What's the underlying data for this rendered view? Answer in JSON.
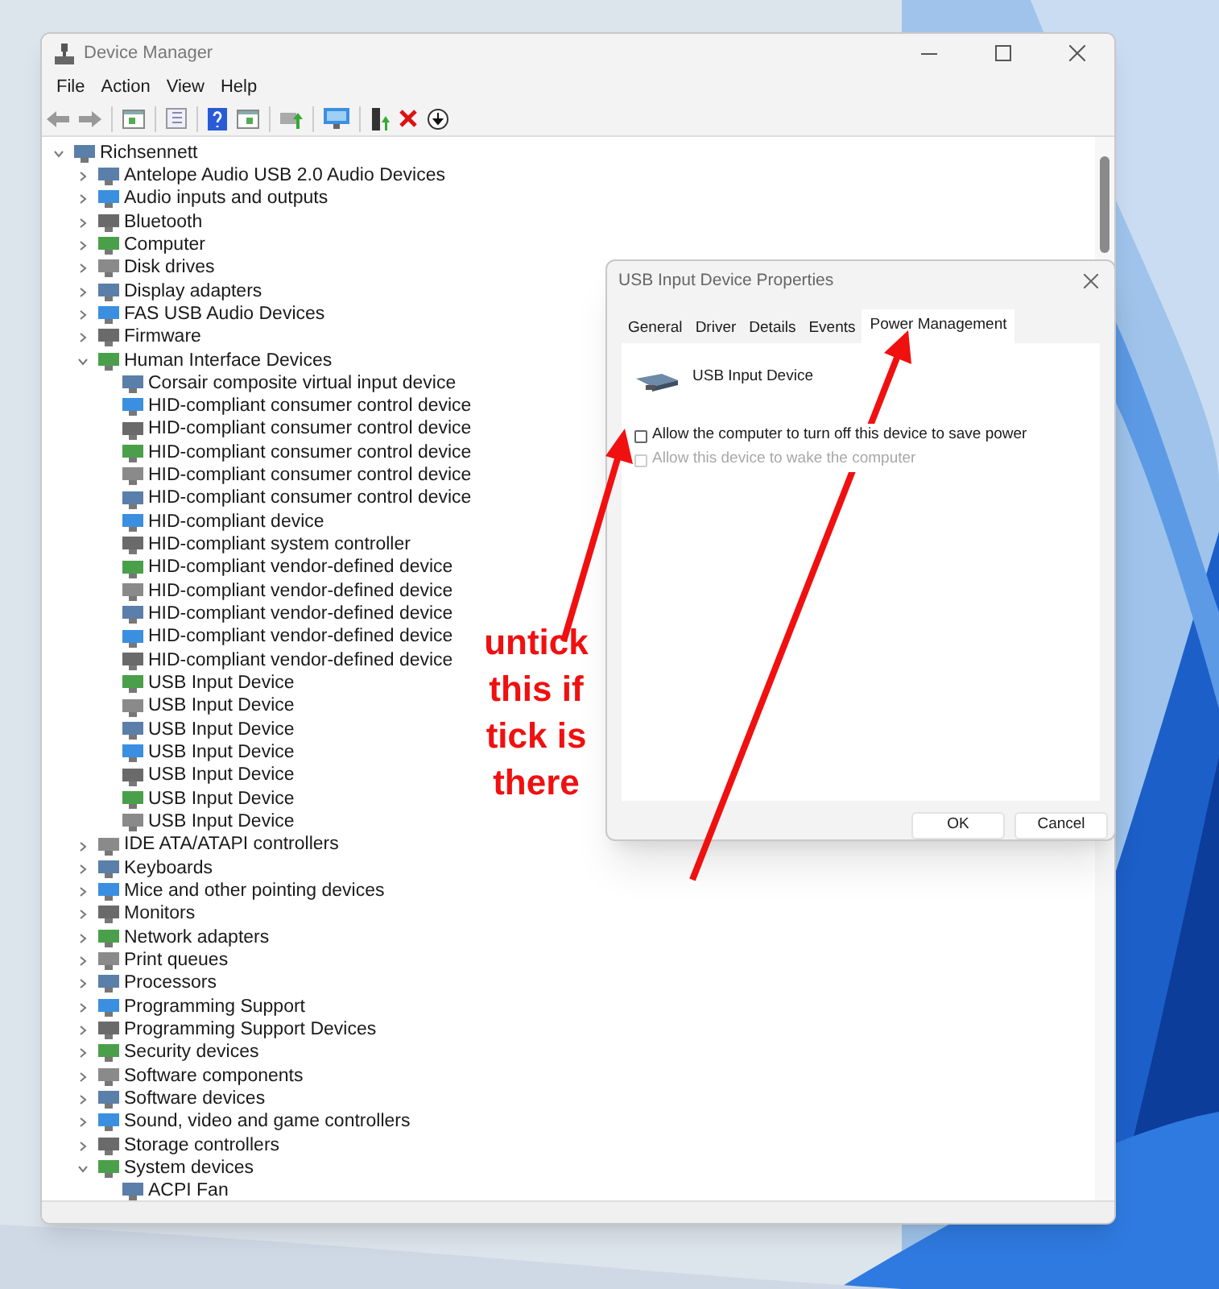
{
  "window": {
    "title": "Device Manager"
  },
  "menu": [
    "File",
    "Action",
    "View",
    "Help"
  ],
  "tree": {
    "label": "Richsennett",
    "expanded": true,
    "children": [
      {
        "label": "Antelope Audio USB 2.0 Audio Devices",
        "expanded": false
      },
      {
        "label": "Audio inputs and outputs",
        "expanded": false
      },
      {
        "label": "Bluetooth",
        "expanded": false
      },
      {
        "label": "Computer",
        "expanded": false
      },
      {
        "label": "Disk drives",
        "expanded": false
      },
      {
        "label": "Display adapters",
        "expanded": false
      },
      {
        "label": "FAS USB Audio Devices",
        "expanded": false
      },
      {
        "label": "Firmware",
        "expanded": false
      },
      {
        "label": "Human Interface Devices",
        "expanded": true,
        "children": [
          {
            "label": "Corsair composite virtual input device"
          },
          {
            "label": "HID-compliant consumer control device"
          },
          {
            "label": "HID-compliant consumer control device"
          },
          {
            "label": "HID-compliant consumer control device"
          },
          {
            "label": "HID-compliant consumer control device"
          },
          {
            "label": "HID-compliant consumer control device"
          },
          {
            "label": "HID-compliant device"
          },
          {
            "label": "HID-compliant system controller"
          },
          {
            "label": "HID-compliant vendor-defined device"
          },
          {
            "label": "HID-compliant vendor-defined device"
          },
          {
            "label": "HID-compliant vendor-defined device"
          },
          {
            "label": "HID-compliant vendor-defined device"
          },
          {
            "label": "HID-compliant vendor-defined device"
          },
          {
            "label": "USB Input Device"
          },
          {
            "label": "USB Input Device"
          },
          {
            "label": "USB Input Device"
          },
          {
            "label": "USB Input Device"
          },
          {
            "label": "USB Input Device"
          },
          {
            "label": "USB Input Device"
          },
          {
            "label": "USB Input Device"
          }
        ]
      },
      {
        "label": "IDE ATA/ATAPI controllers",
        "expanded": false
      },
      {
        "label": "Keyboards",
        "expanded": false
      },
      {
        "label": "Mice and other pointing devices",
        "expanded": false
      },
      {
        "label": "Monitors",
        "expanded": false
      },
      {
        "label": "Network adapters",
        "expanded": false
      },
      {
        "label": "Print queues",
        "expanded": false
      },
      {
        "label": "Processors",
        "expanded": false
      },
      {
        "label": "Programming Support",
        "expanded": false
      },
      {
        "label": "Programming Support Devices",
        "expanded": false
      },
      {
        "label": "Security devices",
        "expanded": false
      },
      {
        "label": "Software components",
        "expanded": false
      },
      {
        "label": "Software devices",
        "expanded": false
      },
      {
        "label": "Sound, video and game controllers",
        "expanded": false
      },
      {
        "label": "Storage controllers",
        "expanded": false
      },
      {
        "label": "System devices",
        "expanded": true,
        "children": [
          {
            "label": "ACPI Fan"
          }
        ]
      }
    ]
  },
  "dialog": {
    "title": "USB Input Device Properties",
    "tabs": [
      {
        "label": "General",
        "selected": false
      },
      {
        "label": "Driver",
        "selected": false
      },
      {
        "label": "Details",
        "selected": false
      },
      {
        "label": "Events",
        "selected": false
      },
      {
        "label": "Power Management",
        "selected": true
      }
    ],
    "device_name": "USB Input Device",
    "options": [
      {
        "label": "Allow the computer to turn off this device to save power",
        "checked": false,
        "disabled": false
      },
      {
        "label": "Allow this device to wake the computer",
        "checked": false,
        "disabled": true
      }
    ],
    "buttons": [
      "OK",
      "Cancel"
    ]
  },
  "annotation": "untick this if tick is there"
}
